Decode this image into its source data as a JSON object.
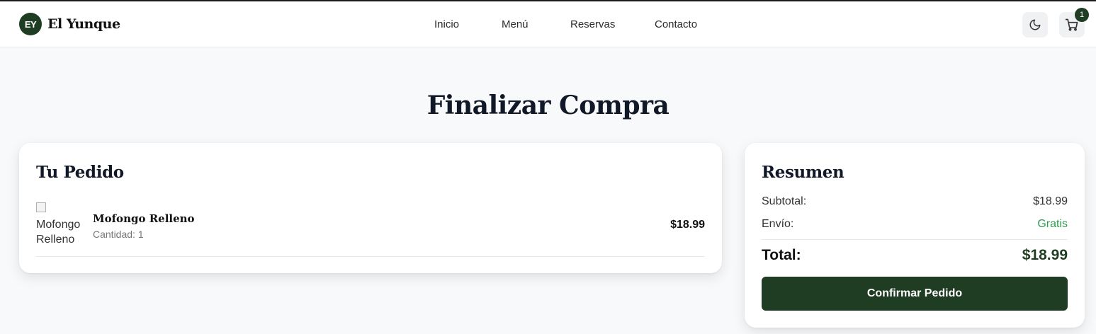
{
  "brand": {
    "initials": "EY",
    "name": "El Yunque"
  },
  "nav": {
    "items": [
      "Inicio",
      "Menú",
      "Reservas",
      "Contacto"
    ]
  },
  "header_actions": {
    "theme_icon": "moon-icon",
    "cart_icon": "cart-icon",
    "cart_count": "1"
  },
  "page": {
    "title": "Finalizar Compra"
  },
  "order": {
    "title": "Tu Pedido",
    "items": [
      {
        "image_alt": "Mofongo Relleno",
        "name": "Mofongo Relleno",
        "quantity_label": "Cantidad: 1",
        "price": "$18.99"
      }
    ]
  },
  "summary": {
    "title": "Resumen",
    "subtotal_label": "Subtotal:",
    "subtotal_value": "$18.99",
    "shipping_label": "Envío:",
    "shipping_value": "Gratis",
    "total_label": "Total:",
    "total_value": "$18.99",
    "confirm_label": "Confirmar Pedido"
  },
  "colors": {
    "brand_green": "#1f3d22",
    "free_green": "#2e9a4e",
    "page_bg": "#f8f9fb"
  }
}
